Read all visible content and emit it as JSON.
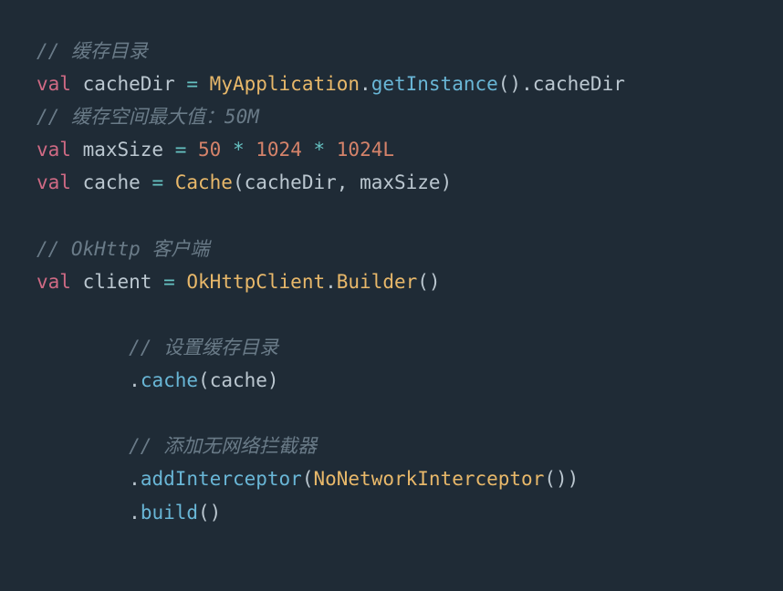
{
  "lines": {
    "l1_comment": "// 缓存目录",
    "l2_val": "val ",
    "l2_ident": "cacheDir ",
    "l2_eq": "= ",
    "l2_class": "MyApplication",
    "l2_dot1": ".",
    "l2_method": "getInstance",
    "l2_paren": "().",
    "l3_ident": "cacheDir",
    "l4_comment": "// 缓存空间最大值：50M",
    "l5_val": "val ",
    "l5_ident": "maxSize ",
    "l5_eq": "= ",
    "l5_n1": "50",
    "l5_star1": " * ",
    "l5_n2": "1024",
    "l5_star2": " * ",
    "l5_n3": "1024L",
    "l6_val": "val ",
    "l6_ident": "cache ",
    "l6_eq": "= ",
    "l6_class": "Cache",
    "l6_open": "(",
    "l6_arg1": "cacheDir",
    "l6_comma": ", ",
    "l6_arg2": "maxSize",
    "l6_close": ")",
    "l8_comment": "// OkHttp 客户端",
    "l9_val": "val ",
    "l9_ident": "client ",
    "l9_eq": "= ",
    "l9_class": "OkHttpClient",
    "l9_dot": ".",
    "l9_builder": "Builder",
    "l9_paren": "()",
    "l11_indent": "        ",
    "l11_comment": "// 设置缓存目录",
    "l12_indent": "        ",
    "l12_dot": ".",
    "l12_method": "cache",
    "l12_open": "(",
    "l12_arg": "cache",
    "l12_close": ")",
    "l14_indent": "        ",
    "l14_comment": "// 添加无网络拦截器",
    "l15_indent": "        ",
    "l15_dot": ".",
    "l15_method": "addInterceptor",
    "l15_open": "(",
    "l15_class": "NoNetworkInterceptor",
    "l15_paren": "()",
    "l15_close": ")",
    "l16_indent": "        ",
    "l16_dot": ".",
    "l16_method": "build",
    "l16_paren": "()"
  }
}
